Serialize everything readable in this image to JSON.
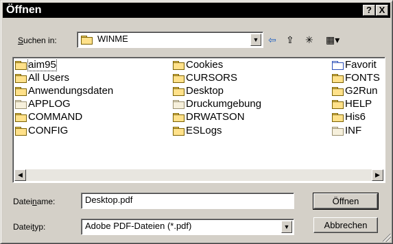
{
  "window": {
    "title": "Öffnen"
  },
  "titlebar": {
    "help_label": "?",
    "close_label": "X"
  },
  "lookin": {
    "label_pre": "",
    "label_accel": "S",
    "label_post": "uchen in:",
    "value": "WINME"
  },
  "toolbar": {
    "back_glyph": "⇦",
    "up_glyph": "⇪",
    "newfolder_glyph": "✳",
    "view_glyph": "▦▾"
  },
  "files": [
    {
      "name": "aim95",
      "icon": "folder"
    },
    {
      "name": "All Users",
      "icon": "folder"
    },
    {
      "name": "Anwendungsdaten",
      "icon": "folder"
    },
    {
      "name": "APPLOG",
      "icon": "folder-ghost"
    },
    {
      "name": "COMMAND",
      "icon": "folder"
    },
    {
      "name": "CONFIG",
      "icon": "folder"
    },
    {
      "name": "Cookies",
      "icon": "folder"
    },
    {
      "name": "CURSORS",
      "icon": "folder"
    },
    {
      "name": "Desktop",
      "icon": "folder"
    },
    {
      "name": "Druckumgebung",
      "icon": "folder-ghost"
    },
    {
      "name": "DRWATSON",
      "icon": "folder"
    },
    {
      "name": "ESLogs",
      "icon": "folder"
    },
    {
      "name": "Favorit",
      "icon": "folder-favorites"
    },
    {
      "name": "FONTS",
      "icon": "folder"
    },
    {
      "name": "G2Run",
      "icon": "folder"
    },
    {
      "name": "HELP",
      "icon": "folder"
    },
    {
      "name": "His6",
      "icon": "folder"
    },
    {
      "name": "INF",
      "icon": "folder-ghost"
    }
  ],
  "scrollbar": {
    "left_glyph": "◀",
    "right_glyph": "▶"
  },
  "filename": {
    "label_pre": "Datei",
    "label_accel": "n",
    "label_post": "ame:",
    "value": "Desktop.pdf"
  },
  "filetype": {
    "label_pre": "Datei",
    "label_accel": "t",
    "label_post": "yp:",
    "value": "Adobe PDF-Dateien (*.pdf)"
  },
  "buttons": {
    "open": "Öffnen",
    "cancel": "Abbrechen"
  },
  "dropdown_glyph": "▼"
}
